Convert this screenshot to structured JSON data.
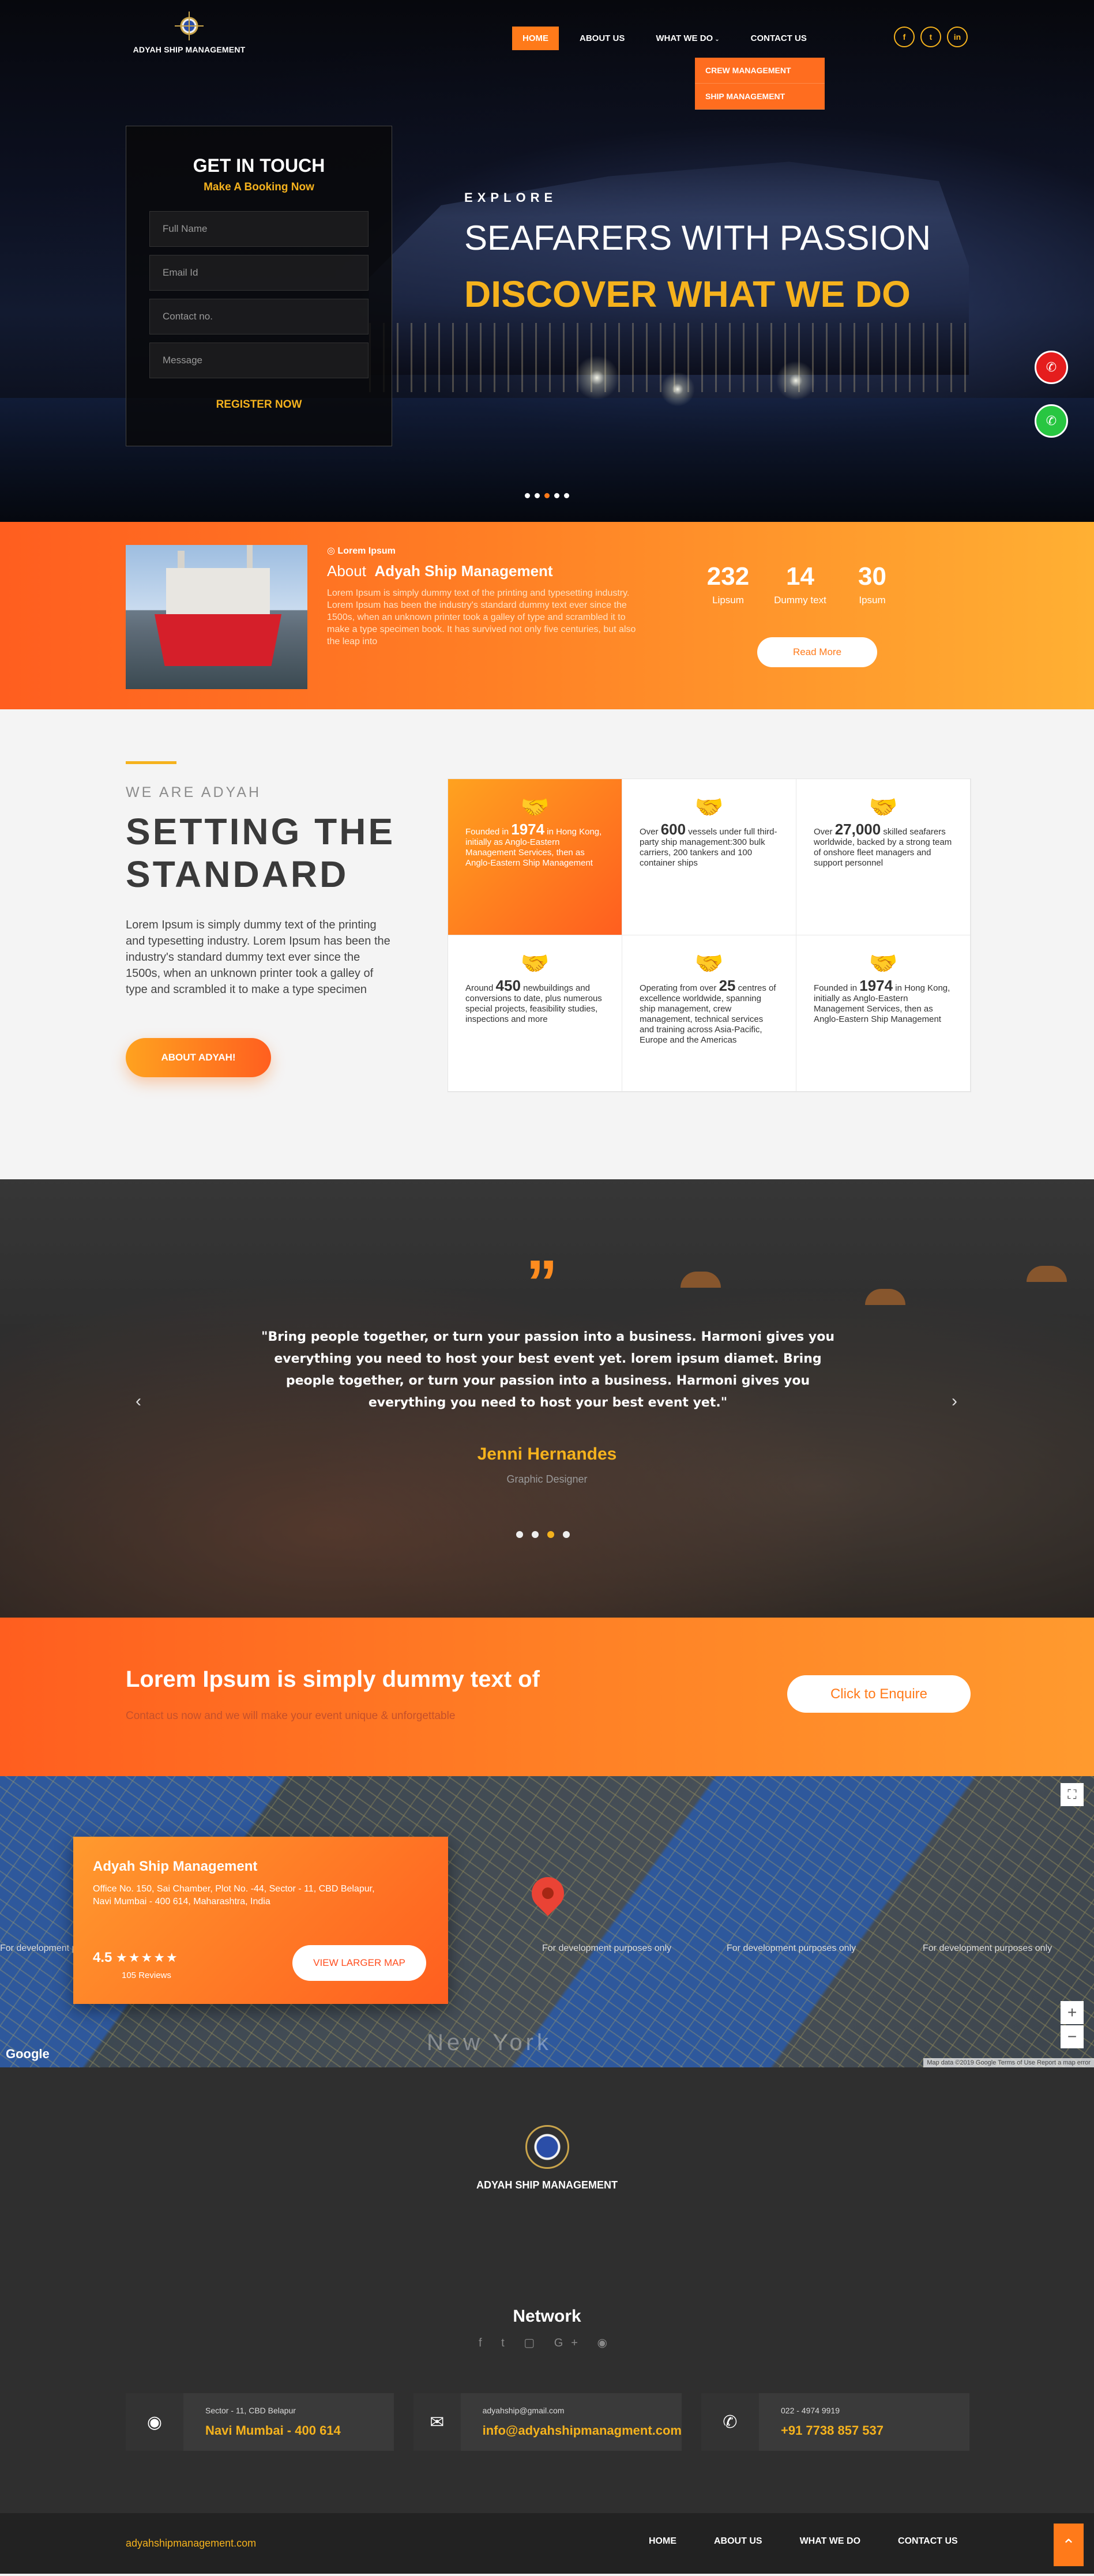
{
  "brand": {
    "name": "ADYAH SHIP MANAGEMENT"
  },
  "nav": {
    "items": [
      "HOME",
      "ABOUT US",
      "WHAT WE DO",
      "CONTACT US"
    ],
    "dropdown": [
      "CREW MANAGEMENT",
      "SHIP MANAGEMENT"
    ]
  },
  "socials": [
    "f",
    "t",
    "in"
  ],
  "form": {
    "title": "GET IN TOUCH",
    "subtitle": "Make A Booking Now",
    "fields": [
      "Full Name",
      "Email Id",
      "Contact no.",
      "Message"
    ],
    "submit": "REGISTER NOW"
  },
  "hero": {
    "kicker": "EXPLORE",
    "headline": "SEAFARERS WITH PASSION",
    "subhead": "DISCOVER WHAT WE DO"
  },
  "about": {
    "kicker": "Lorem Ipsum",
    "title_prefix": "About",
    "title_bold": "Adyah Ship Management",
    "description": "Lorem Ipsum is simply dummy text of the printing and typesetting industry. Lorem Ipsum has been the industry's standard dummy text ever since the 1500s, when an unknown printer took a galley of type and scrambled it to make a type specimen book. It has survived not only five centuries, but also the leap into",
    "stats": [
      {
        "value": "232",
        "label": "Lipsum"
      },
      {
        "value": "14",
        "label": "Dummy text"
      },
      {
        "value": "30",
        "label": "Ipsum"
      }
    ],
    "read_more": "Read More"
  },
  "standard": {
    "kicker": "WE ARE ADYAH",
    "title_line1": "SETTING THE",
    "title_line2": "STANDARD",
    "body": "Lorem Ipsum is simply dummy text of the printing and typesetting industry. Lorem Ipsum has been the industry's standard dummy text ever since the 1500s, when an unknown printer took a galley of type and scrambled it to make a type specimen",
    "button": "ABOUT ADYAH!",
    "cards": [
      {
        "pre": "Founded in ",
        "num": "1974",
        "post": " in Hong Kong, initially as Anglo-Eastern Management Services, then as Anglo-Eastern Ship Management"
      },
      {
        "pre": "Over ",
        "num": "600",
        "post": " vessels under full third-party ship management:300 bulk carriers, 200 tankers and 100 container ships"
      },
      {
        "pre": "Over ",
        "num": "27,000",
        "post": " skilled seafarers worldwide, backed by a strong team of onshore fleet managers and support personnel"
      },
      {
        "pre": "Around ",
        "num": "450",
        "post": " newbuildings and conversions to date, plus numerous special projects, feasibility studies, inspections and more"
      },
      {
        "pre": "Operating from over ",
        "num": "25",
        "post": " centres of excellence worldwide, spanning ship management, crew management, technical services and training across Asia-Pacific, Europe and the Americas"
      },
      {
        "pre": "Founded in ",
        "num": "1974",
        "post": " in Hong Kong, initially as Anglo-Eastern Management Services, then as Anglo-Eastern Ship Management"
      }
    ]
  },
  "testimonial": {
    "quote": "\"Bring people together, or turn your passion into a business. Harmoni gives you everything you need to host your best event yet. lorem ipsum diamet. Bring people together, or turn your passion into a business. Harmoni gives you everything you need to host your best event yet.\"",
    "author": "Jenni Hernandes",
    "role": "Graphic Designer"
  },
  "enquire": {
    "title": "Lorem Ipsum is simply dummy text of",
    "subtitle": "Contact us now and we will make your event unique & unforgettable",
    "button": "Click to Enquire"
  },
  "map": {
    "name": "Adyah Ship Management",
    "address": "Office No. 150, Sai Chamber, Plot No. -44, Sector - 11, CBD Belapur,  Navi Mumbai - 400 614, Maharashtra, India",
    "rating": "4.5",
    "reviews": "105 Reviews",
    "larger": "VIEW LARGER MAP",
    "dev_text": "For development purposes only",
    "footer": "Map data ©2019 Google   Terms of Use   Report a map error",
    "google": "Google",
    "city": "New York"
  },
  "footer": {
    "brand": "ADYAH SHIP MANAGEMENT",
    "network": "Network",
    "contacts": [
      {
        "line1": "Sector - 11, CBD Belapur",
        "line2": "Navi Mumbai - 400 614"
      },
      {
        "line1": "adyahship@gmail.com",
        "line2": "info@adyahshipmanagment.com"
      },
      {
        "line1": "022 - 4974 9919",
        "line2": "+91 7738 857 537"
      }
    ],
    "site": "adyahshipmanagement.com",
    "links": [
      "HOME",
      "ABOUT US",
      "WHAT WE DO",
      "CONTACT US"
    ]
  }
}
